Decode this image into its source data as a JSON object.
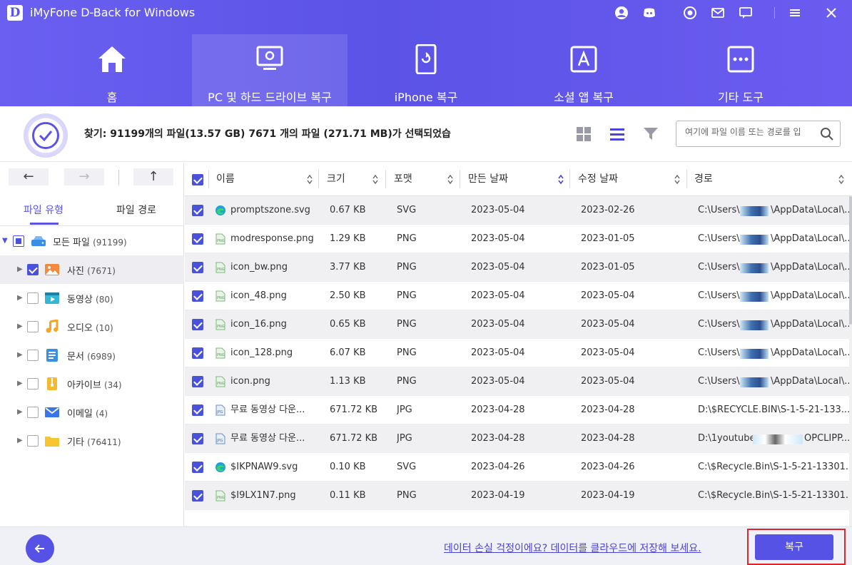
{
  "window": {
    "logo_letter": "D",
    "title": "iMyFone D-Back for Windows",
    "icons": [
      "user-icon",
      "discord-icon",
      "settings-icon",
      "mail-icon",
      "chat-icon",
      "menu-icon",
      "close-icon"
    ]
  },
  "nav": {
    "items": [
      {
        "label": "홈",
        "icon": "home-icon"
      },
      {
        "label": "PC 및 하드 드라이브 복구",
        "icon": "pc-recovery-icon",
        "active": true
      },
      {
        "label": "iPhone 복구",
        "icon": "iphone-icon"
      },
      {
        "label": "소셜 앱 복구",
        "icon": "app-store-icon"
      },
      {
        "label": "기타 도구",
        "icon": "more-tools-icon"
      }
    ]
  },
  "summary": {
    "text": "찾기: 91199개의 파일(13.57 GB) 7671 개의 파일 (271.71 MB)가 선택되었습",
    "search_placeholder": "여기에 파일 이름 또는 경로를 입"
  },
  "left_panel": {
    "tabs": [
      "파일 유형",
      "파일 경로"
    ],
    "active_tab": 0,
    "root": {
      "label": "모든 파일",
      "count": "(91199)"
    },
    "categories": [
      {
        "label": "사진",
        "count": "(7671)",
        "checked": true,
        "icon": "photo-icon",
        "color": "#f58a3c"
      },
      {
        "label": "동영상",
        "count": "(80)",
        "checked": false,
        "icon": "video-icon",
        "color": "#35b6d6"
      },
      {
        "label": "오디오",
        "count": "(10)",
        "checked": false,
        "icon": "music-icon",
        "color": "#f5a623"
      },
      {
        "label": "문서",
        "count": "(6989)",
        "checked": false,
        "icon": "document-icon",
        "color": "#3a8ee6"
      },
      {
        "label": "아카이브",
        "count": "(34)",
        "checked": false,
        "icon": "archive-icon",
        "color": "#f5b82e"
      },
      {
        "label": "이메일",
        "count": "(4)",
        "checked": false,
        "icon": "email-icon",
        "color": "#3a76e6"
      },
      {
        "label": "기타",
        "count": "(76411)",
        "checked": false,
        "icon": "folder-icon",
        "color": "#f7c531"
      }
    ]
  },
  "table": {
    "columns": [
      "이름",
      "크기",
      "포맷",
      "만든 날짜",
      "수정 날짜",
      "경로"
    ],
    "rows": [
      {
        "name": "promptszone.svg",
        "size": "0.67 KB",
        "format": "SVG",
        "created": "2023-05-04",
        "modified": "2023-02-26",
        "path_a": "C:\\Users\\",
        "path_b": "\\AppData\\Local\\...",
        "type": "svg"
      },
      {
        "name": "modresponse.png",
        "size": "1.29 KB",
        "format": "PNG",
        "created": "2023-05-04",
        "modified": "2023-01-05",
        "path_a": "C:\\Users\\",
        "path_b": "\\AppData\\Local\\...",
        "type": "png"
      },
      {
        "name": "icon_bw.png",
        "size": "3.77 KB",
        "format": "PNG",
        "created": "2023-05-04",
        "modified": "2023-01-05",
        "path_a": "C:\\Users\\",
        "path_b": "\\AppData\\Local\\...",
        "type": "png"
      },
      {
        "name": "icon_48.png",
        "size": "2.50 KB",
        "format": "PNG",
        "created": "2023-05-04",
        "modified": "2023-05-04",
        "path_a": "C:\\Users\\",
        "path_b": "\\AppData\\Local\\...",
        "type": "png"
      },
      {
        "name": "icon_16.png",
        "size": "0.65 KB",
        "format": "PNG",
        "created": "2023-05-04",
        "modified": "2023-05-04",
        "path_a": "C:\\Users\\",
        "path_b": "\\AppData\\Local\\...",
        "type": "png"
      },
      {
        "name": "icon_128.png",
        "size": "6.07 KB",
        "format": "PNG",
        "created": "2023-05-04",
        "modified": "2023-05-04",
        "path_a": "C:\\Users\\",
        "path_b": "\\AppData\\Local\\...",
        "type": "png"
      },
      {
        "name": "icon.png",
        "size": "1.13 KB",
        "format": "PNG",
        "created": "2023-05-04",
        "modified": "2023-05-04",
        "path_a": "C:\\Users\\",
        "path_b": "\\AppData\\Local\\...",
        "type": "png"
      },
      {
        "name": "무료 동영상 다운...",
        "size": "671.72 KB",
        "format": "JPG",
        "created": "2023-04-28",
        "modified": "2023-04-28",
        "path_a": "D:\\$RECYCLE.BIN\\S-1-5-21-133...",
        "path_b": "",
        "type": "jpg"
      },
      {
        "name": "무료 동영상 다운...",
        "size": "671.72 KB",
        "format": "JPG",
        "created": "2023-04-28",
        "modified": "2023-04-28",
        "path_a": "D:\\1youtube",
        "path_b": "OPCLIPP...",
        "type": "jpg"
      },
      {
        "name": "$IKPNAW9.svg",
        "size": "0.10 KB",
        "format": "SVG",
        "created": "2023-04-26",
        "modified": "2023-04-26",
        "path_a": "C:\\$Recycle.Bin\\S-1-5-21-13301...",
        "path_b": "",
        "type": "svg"
      },
      {
        "name": "$I9LX1N7.png",
        "size": "0.11 KB",
        "format": "PNG",
        "created": "2023-04-19",
        "modified": "2023-04-19",
        "path_a": "C:\\$Recycle.Bin\\S-1-5-21-13301...",
        "path_b": "",
        "type": "png"
      }
    ]
  },
  "footer": {
    "cloud_link": "데이터 손실 걱정이에요? 데이터를 클라우드에 저장해 보세요.",
    "recover_label": "복구"
  },
  "colors": {
    "accent": "#5652e6",
    "header_gradient_start": "#6a5ff1",
    "highlight_outline": "#e0242a"
  }
}
